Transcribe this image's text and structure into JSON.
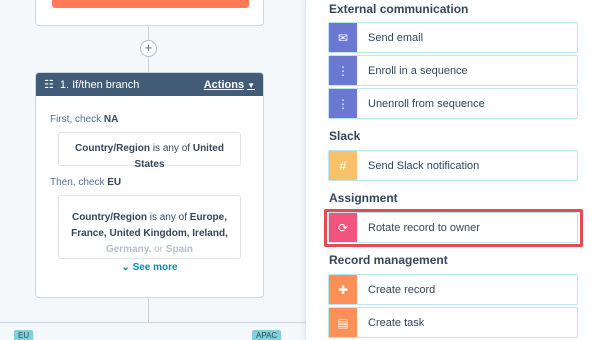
{
  "canvas": {
    "branch": {
      "title": "1. If/then branch",
      "actions_label": "Actions",
      "first_check_prefix": "First, check",
      "first_check_name": "NA",
      "first_condition": {
        "field": "Country/Region",
        "op": "is any of",
        "value": "United States"
      },
      "then_check_prefix": "Then, check",
      "then_check_name": "EU",
      "second_condition": {
        "field": "Country/Region",
        "op": "is any of",
        "values_line1": "Europe,",
        "values_line2a": "France,",
        "values_line2b": "United Kingdom,",
        "values_line2c": "Ireland,",
        "values_line3a": "Germany,",
        "values_line3b": "or",
        "values_line3c": "Spain"
      },
      "see_more": "See more"
    },
    "plus": "+",
    "tag_left": "EU",
    "tag_right": "APAC"
  },
  "panel": {
    "sections": [
      {
        "title": "External communication",
        "items": [
          {
            "label": "Send email",
            "icon": "envelope-icon",
            "color": "#6a78d1"
          },
          {
            "label": "Enroll in a sequence",
            "icon": "sequence-icon",
            "color": "#6a78d1"
          },
          {
            "label": "Unenroll from sequence",
            "icon": "sequence-icon",
            "color": "#6a78d1"
          }
        ]
      },
      {
        "title": "Slack",
        "items": [
          {
            "label": "Send Slack notification",
            "icon": "slack-icon",
            "color": "#f5c26b"
          }
        ]
      },
      {
        "title": "Assignment",
        "items": [
          {
            "label": "Rotate record to owner",
            "icon": "rotate-owner-icon",
            "color": "#f2547d"
          }
        ]
      },
      {
        "title": "Record management",
        "items": [
          {
            "label": "Create record",
            "icon": "create-record-icon",
            "color": "#ff8f59"
          },
          {
            "label": "Create task",
            "icon": "task-icon",
            "color": "#ff8f59"
          }
        ]
      }
    ],
    "highlight_color": "#e8484f"
  }
}
